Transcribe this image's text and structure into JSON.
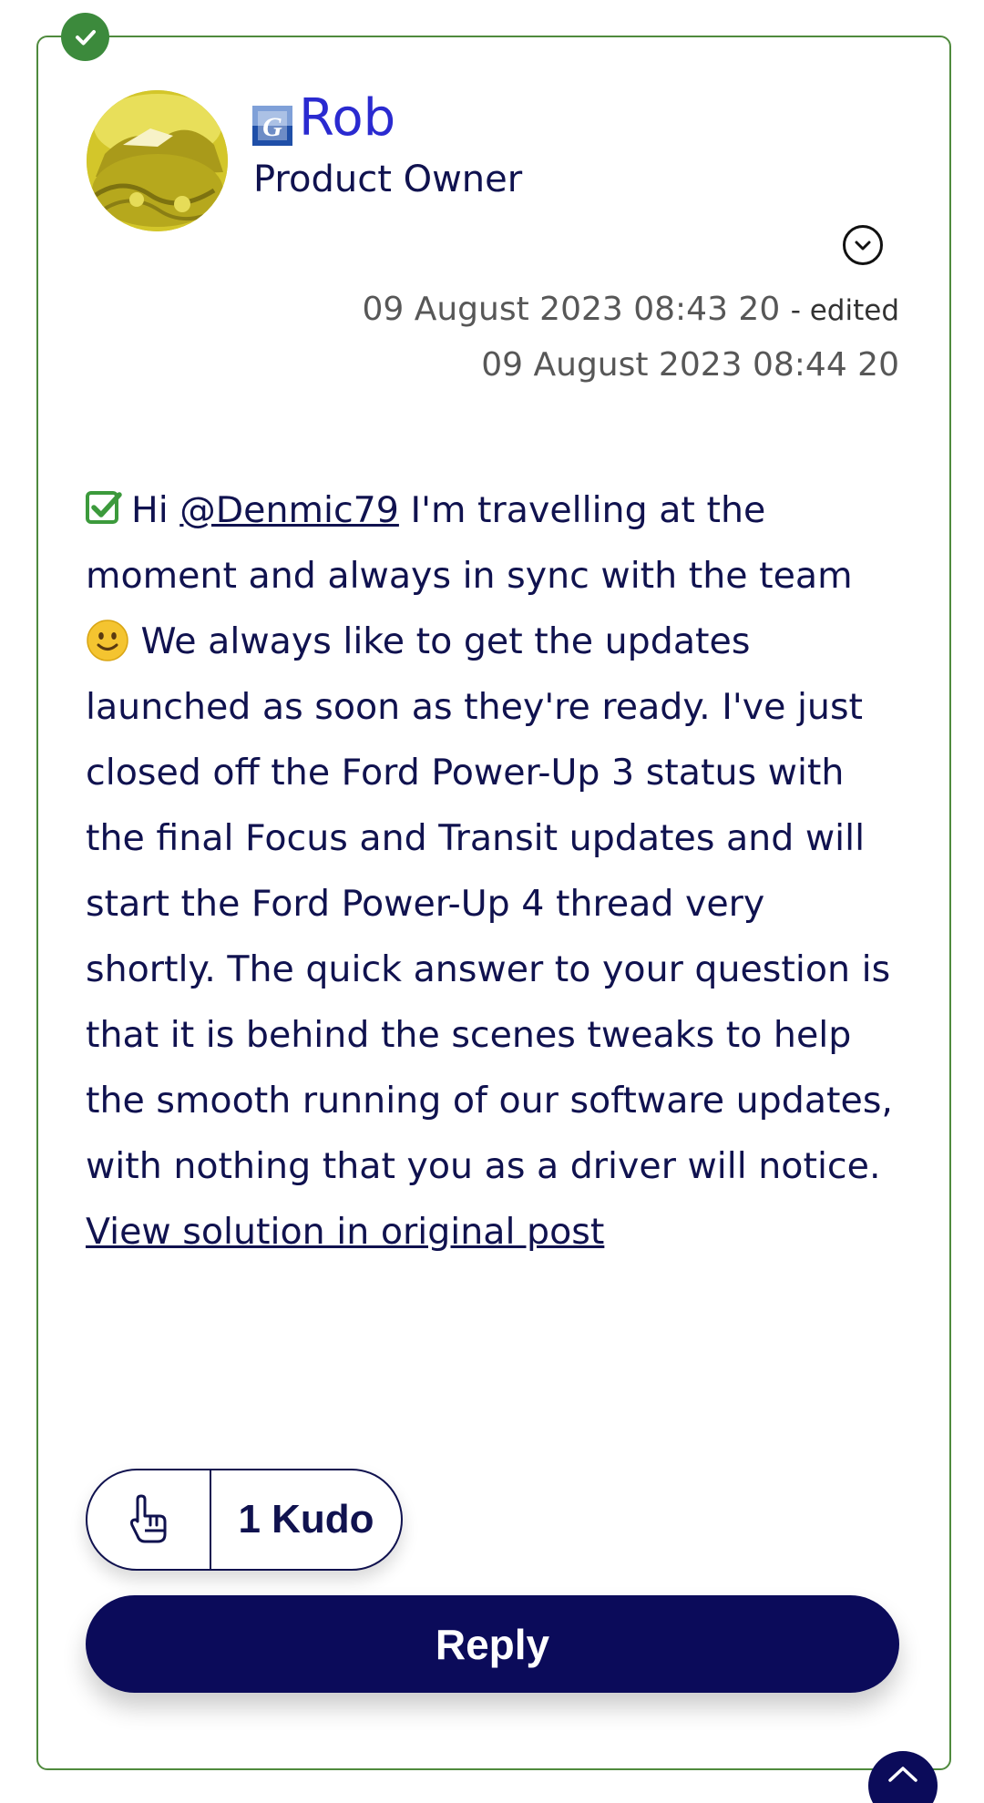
{
  "author": {
    "name": "Rob",
    "role": "Product Owner",
    "avatar_icon": "avatar-image",
    "rank_icon": "ford-rank-icon"
  },
  "post": {
    "date_line_1": "09 August 2023 08:43 20",
    "edited_label": "- edited",
    "date_line_2": "09 August 2023 08:44 20",
    "mention": "@Denmic79",
    "greeting": "Hi ",
    "body_part_1": " I'm travelling at the moment and always in sync with the team ",
    "body_part_2": " We always like to get the updates launched as soon as they're ready.  I've just closed off the Ford Power-Up 3 status with the final Focus and Transit updates and will start the Ford Power-Up 4 thread very shortly.  The quick answer to your question is that it is behind the scenes tweaks to help the smooth running of our software updates, with nothing that you as a driver will notice.",
    "view_solution_label": "View solution in original post"
  },
  "kudos": {
    "label": "1 Kudo",
    "count": 1
  },
  "reply_label": "Reply",
  "colors": {
    "accent_navy": "#0b0b5a",
    "text": "#10124f",
    "username": "#2a2ad0",
    "solution_green": "#3c8a3c",
    "card_border": "#4f8a3d"
  }
}
